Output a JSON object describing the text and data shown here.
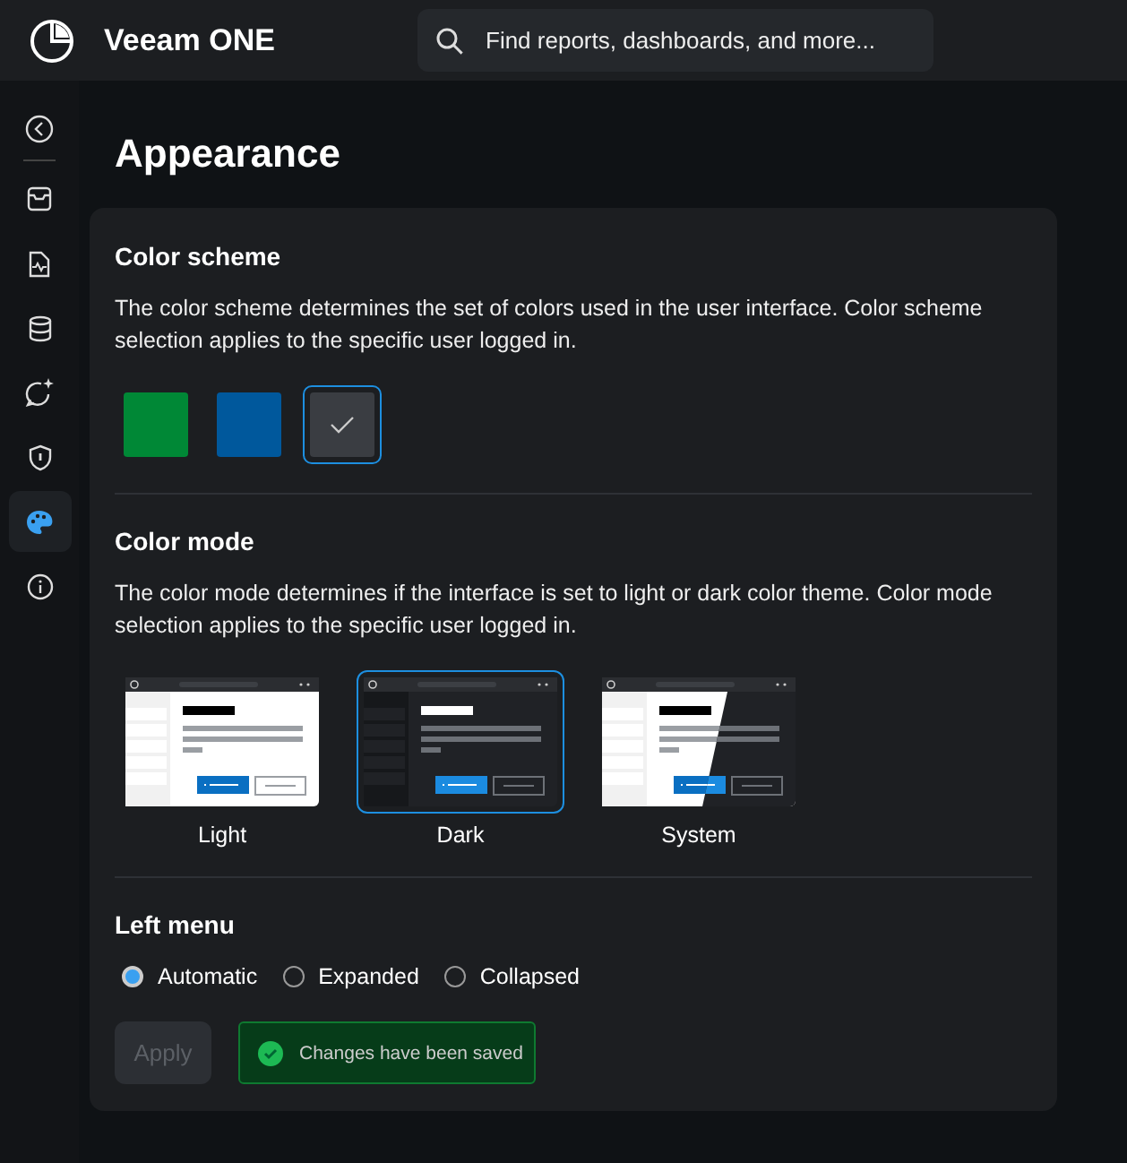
{
  "header": {
    "app_name": "Veeam ONE",
    "search": {
      "placeholder": "Find reports, dashboards, and more..."
    }
  },
  "sidebar": {
    "items": [
      {
        "selected": false
      },
      {
        "selected": false
      },
      {
        "selected": false
      },
      {
        "selected": false
      },
      {
        "selected": false
      },
      {
        "selected": true
      },
      {
        "selected": false
      }
    ]
  },
  "page_title": "Appearance",
  "color_scheme": {
    "title": "Color scheme",
    "description": "The color scheme determines the set of colors used in the user interface. Color scheme selection applies to the specific user logged in.",
    "swatches": [
      {
        "color": "#008836",
        "selected": false
      },
      {
        "color": "#00589c",
        "selected": false
      },
      {
        "color": "#3a3d42",
        "selected": true
      }
    ]
  },
  "color_mode": {
    "title": "Color mode",
    "description": "The color mode determines if the interface is set to light or dark color theme. Color mode selection applies to the specific user logged in.",
    "options": [
      {
        "kind": "light",
        "label": "Light",
        "selected": false
      },
      {
        "kind": "dark",
        "label": "Dark",
        "selected": true
      },
      {
        "kind": "system",
        "label": "System",
        "selected": false
      }
    ]
  },
  "left_menu": {
    "title": "Left menu",
    "options": [
      {
        "label": "Automatic",
        "selected": true
      },
      {
        "label": "Expanded",
        "selected": false
      },
      {
        "label": "Collapsed",
        "selected": false
      }
    ]
  },
  "apply_button": {
    "label": "Apply",
    "disabled": true
  },
  "toast": {
    "text": "Changes have been saved"
  }
}
